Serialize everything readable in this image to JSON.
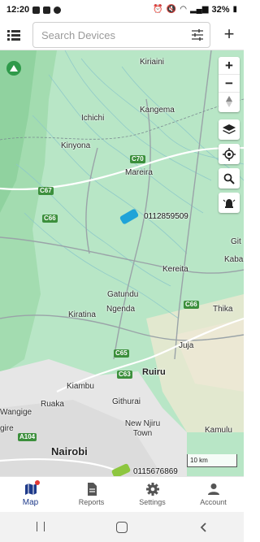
{
  "status_bar": {
    "time": "12:20",
    "battery": "32%"
  },
  "top_bar": {
    "search_placeholder": "Search Devices",
    "add_label": "+"
  },
  "map": {
    "places": [
      {
        "name": "Kiriaini",
        "kind": "place"
      },
      {
        "name": "Ichichi",
        "kind": "place"
      },
      {
        "name": "Kangema",
        "kind": "place"
      },
      {
        "name": "Kinyona",
        "kind": "place"
      },
      {
        "name": "Mareira",
        "kind": "place"
      },
      {
        "name": "Kereita",
        "kind": "place"
      },
      {
        "name": "Gatundu",
        "kind": "place"
      },
      {
        "name": "Ngenda",
        "kind": "place"
      },
      {
        "name": "Kiratina",
        "kind": "place"
      },
      {
        "name": "Thika",
        "kind": "place"
      },
      {
        "name": "Kaba",
        "kind": "place"
      },
      {
        "name": "Git",
        "kind": "place"
      },
      {
        "name": "Juja",
        "kind": "place"
      },
      {
        "name": "Ruiru",
        "kind": "town"
      },
      {
        "name": "Kiambu",
        "kind": "place"
      },
      {
        "name": "Githurai",
        "kind": "place"
      },
      {
        "name": "Ruaka",
        "kind": "place"
      },
      {
        "name": "Wangige",
        "kind": "place"
      },
      {
        "name": "New Njiru Town",
        "kind": "place"
      },
      {
        "name": "Kamulu",
        "kind": "place"
      },
      {
        "name": "Nairobi",
        "kind": "big"
      },
      {
        "name": "gire",
        "kind": "place"
      }
    ],
    "roads": [
      "C70",
      "C67",
      "C66",
      "C66",
      "C65",
      "C63",
      "A104"
    ],
    "vehicles": [
      {
        "id": "0112859509",
        "color": "#1fa3d8"
      },
      {
        "id": "0115676869",
        "color": "#8dc63f"
      }
    ],
    "scale_label": "10 km",
    "zoom_in": "+",
    "zoom_out": "−"
  },
  "bottom_nav": [
    {
      "label": "Map",
      "icon": "map-icon",
      "active": true
    },
    {
      "label": "Reports",
      "icon": "reports-icon",
      "active": false
    },
    {
      "label": "Settings",
      "icon": "gear-icon",
      "active": false
    },
    {
      "label": "Account",
      "icon": "account-icon",
      "active": false
    }
  ],
  "colors": {
    "accent": "#1e3a8a",
    "map_bg": "#b8e6c6",
    "road_shield": "#3c8f3c"
  }
}
